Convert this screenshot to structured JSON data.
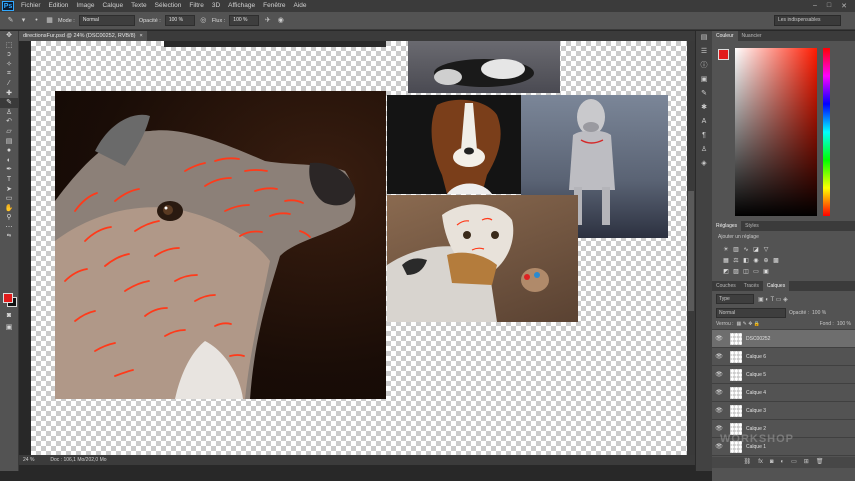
{
  "menubar": {
    "logo": "Ps",
    "items": [
      "Fichier",
      "Edition",
      "Image",
      "Calque",
      "Texte",
      "Sélection",
      "Filtre",
      "3D",
      "Affichage",
      "Fenêtre",
      "Aide"
    ],
    "win_min": "–",
    "win_max": "□",
    "win_close": "✕"
  },
  "options": {
    "mode_label": "Mode :",
    "mode_value": "Normal",
    "opacity_label": "Opacité :",
    "opacity_value": "100 %",
    "flow_label": "Flux :",
    "flow_value": "100 %",
    "workspace": "Les indispensables"
  },
  "document": {
    "tab_title": "directionsFur.psd @ 24% (DSC00252, RVB/8)",
    "tab_close": "×",
    "zoom": "24 %",
    "doc_info": "Doc : 106,1 Mo/202,0 Mo"
  },
  "color_panel": {
    "tabs": [
      "Couleur",
      "Nuancier"
    ],
    "fg": "#e21c1c",
    "bg": "#111111"
  },
  "adjust_panel": {
    "tabs": [
      "Réglages",
      "Styles"
    ],
    "label": "Ajouter un réglage"
  },
  "layers_panel": {
    "tabs": [
      "Couches",
      "Tracés",
      "Calques"
    ],
    "filter_value": "Type",
    "blend_value": "Normal",
    "opacity_label": "Opacité :",
    "opacity_value": "100 %",
    "lock_label": "Verrou :",
    "fill_label": "Fond :",
    "fill_value": "100 %",
    "layers": [
      {
        "name": "DSC00252",
        "selected": true
      },
      {
        "name": "Calque 6",
        "selected": false
      },
      {
        "name": "Calque 5",
        "selected": false
      },
      {
        "name": "Calque 4",
        "selected": false
      },
      {
        "name": "Calque 3",
        "selected": false
      },
      {
        "name": "Calque 2",
        "selected": false
      },
      {
        "name": "Calque 1",
        "selected": false
      }
    ],
    "footer_icons": [
      "link-icon",
      "fx-icon",
      "mask-icon",
      "adjust-icon",
      "folder-icon",
      "new-layer-icon",
      "trash-icon"
    ]
  },
  "watermark": "WORKSHOP"
}
